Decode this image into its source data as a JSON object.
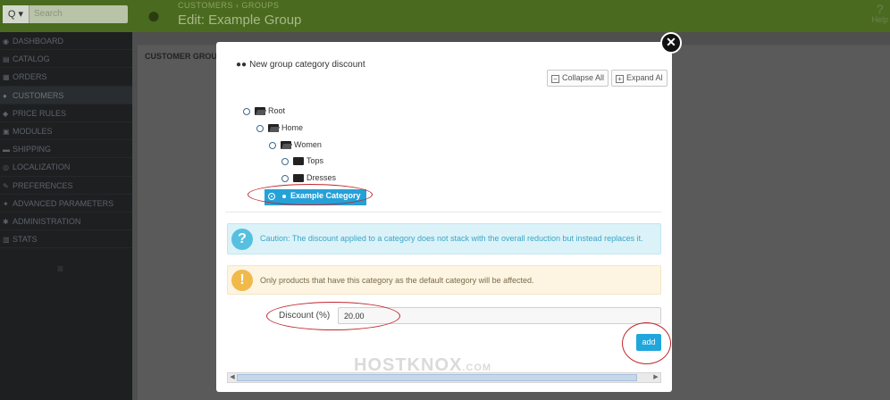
{
  "header": {
    "search_placeholder": "Search",
    "search_button": "Q ▾",
    "breadcrumb": "CUSTOMERS  ›  GROUPS",
    "title": "Edit: Example Group",
    "help_label": "Help"
  },
  "sidebar": {
    "items": [
      {
        "label": "DASHBOARD",
        "icon": "dashboard-icon"
      },
      {
        "label": "CATALOG",
        "icon": "catalog-icon"
      },
      {
        "label": "ORDERS",
        "icon": "orders-icon"
      },
      {
        "label": "CUSTOMERS",
        "icon": "customers-icon",
        "active": true
      },
      {
        "label": "PRICE RULES",
        "icon": "price-rules-icon"
      },
      {
        "label": "MODULES",
        "icon": "modules-icon"
      },
      {
        "label": "SHIPPING",
        "icon": "shipping-icon"
      },
      {
        "label": "LOCALIZATION",
        "icon": "localization-icon"
      },
      {
        "label": "PREFERENCES",
        "icon": "preferences-icon"
      },
      {
        "label": "ADVANCED PARAMETERS",
        "icon": "advanced-parameters-icon"
      },
      {
        "label": "ADMINISTRATION",
        "icon": "administration-icon"
      },
      {
        "label": "STATS",
        "icon": "stats-icon"
      }
    ]
  },
  "panel": {
    "heading": "CUSTOMER GROU"
  },
  "modal": {
    "title": "New group category discount",
    "collapse_all": "Collapse All",
    "expand_all": "Expand Al",
    "tree": {
      "root": "Root",
      "home": "Home",
      "women": "Women",
      "tops": "Tops",
      "dresses": "Dresses",
      "selected": "Example Category"
    },
    "info_alert": "Caution: The discount applied to a category does not stack with the overall reduction but instead replaces it.",
    "warning_alert": "Only products that have this category as the default category will be affected.",
    "discount_label": "Discount (%)",
    "discount_value": "20.00",
    "add_button": "add"
  },
  "watermark": {
    "brand": "HOSTKNOX",
    "tld": ".COM"
  },
  "colors": {
    "header_green": "#4a6b1f",
    "selection_blue": "#25a1d8",
    "info_bg": "#dbf2f8",
    "warn_bg": "#fdf4e1",
    "annotation_red": "#c0272d"
  }
}
